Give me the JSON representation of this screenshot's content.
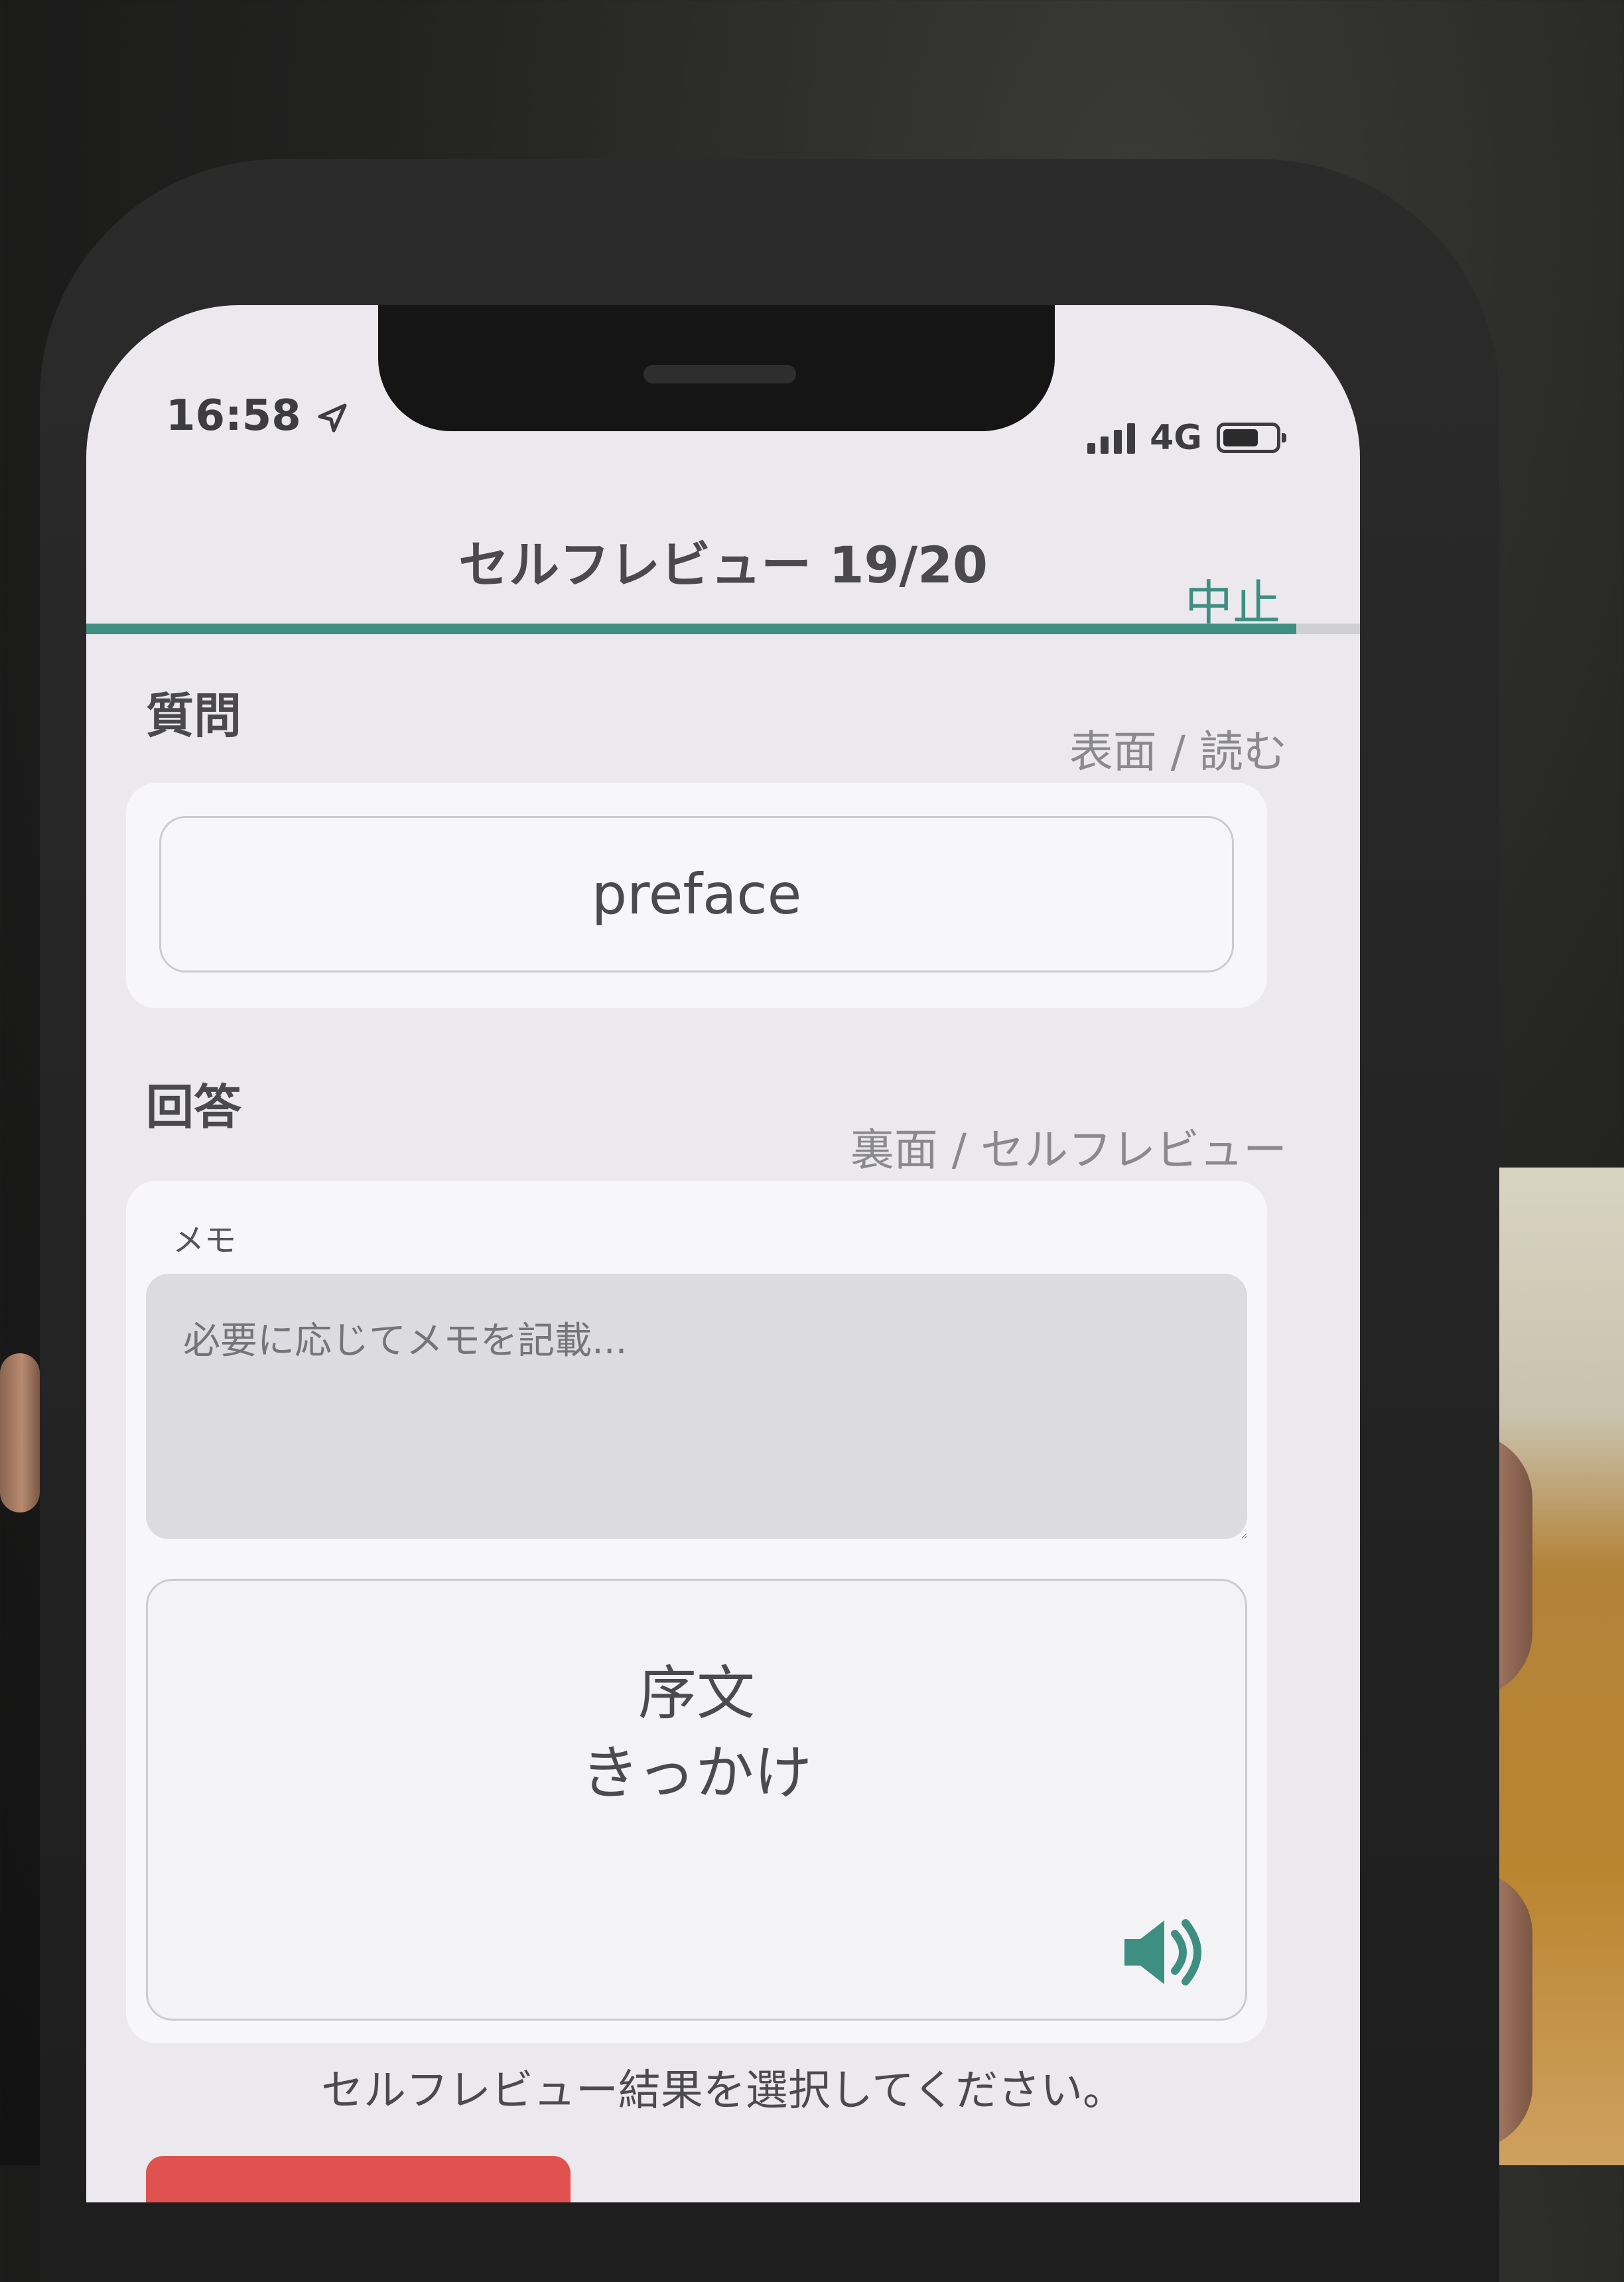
{
  "status_bar": {
    "time": "16:58",
    "network": "4G",
    "icons": [
      "location-arrow-icon",
      "signal-icon",
      "battery-icon"
    ]
  },
  "nav": {
    "title": "セルフレビュー 19/20",
    "action": "中止",
    "progress": 0.95,
    "accent_color": "#3e8f82"
  },
  "question": {
    "title": "質問",
    "side": "表面 / 読む",
    "word": "preface"
  },
  "answer": {
    "title": "回答",
    "side": "裏面 / セルフレビュー",
    "memo_label": "メモ",
    "memo_placeholder": "必要に応じてメモを記載...",
    "meaning": "序文\nきっかけ",
    "speaker_icon": "speaker-icon"
  },
  "footer": {
    "instruction": "セルフレビュー結果を選択してください。"
  }
}
